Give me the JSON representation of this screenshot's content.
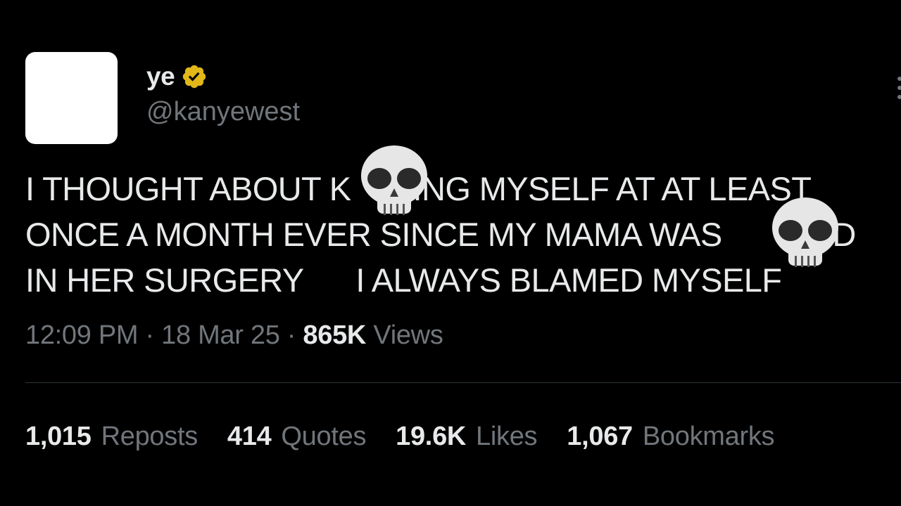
{
  "author": {
    "display_name": "ye",
    "handle": "@kanyewest",
    "verified_badge_color": "#e2b719",
    "avatar_color": "#ffffff"
  },
  "tweet": {
    "lines": [
      "I THOUGHT ABOUT K",
      "ING MYSELF AT AT LEAST",
      "ONCE A MONTH EVER SINCE MY MAMA WAS ",
      "LED",
      "IN HER SURGERY      I ALWAYS BLAMED MYSELF"
    ],
    "overlay_icons": [
      "skull-emoji",
      "skull-emoji"
    ]
  },
  "meta": {
    "time": "12:09 PM",
    "separator": " · ",
    "date": "18 Mar 25",
    "views_count": "865K",
    "views_label": "Views"
  },
  "stats": {
    "reposts": {
      "count": "1,015",
      "label": "Reposts"
    },
    "quotes": {
      "count": "414",
      "label": "Quotes"
    },
    "likes": {
      "count": "19.6K",
      "label": "Likes"
    },
    "bookmarks": {
      "count": "1,067",
      "label": "Bookmarks"
    }
  },
  "colors": {
    "background": "#000000",
    "primary_text": "#e7e9ea",
    "secondary_text": "#71767b",
    "divider": "#2f3336"
  }
}
